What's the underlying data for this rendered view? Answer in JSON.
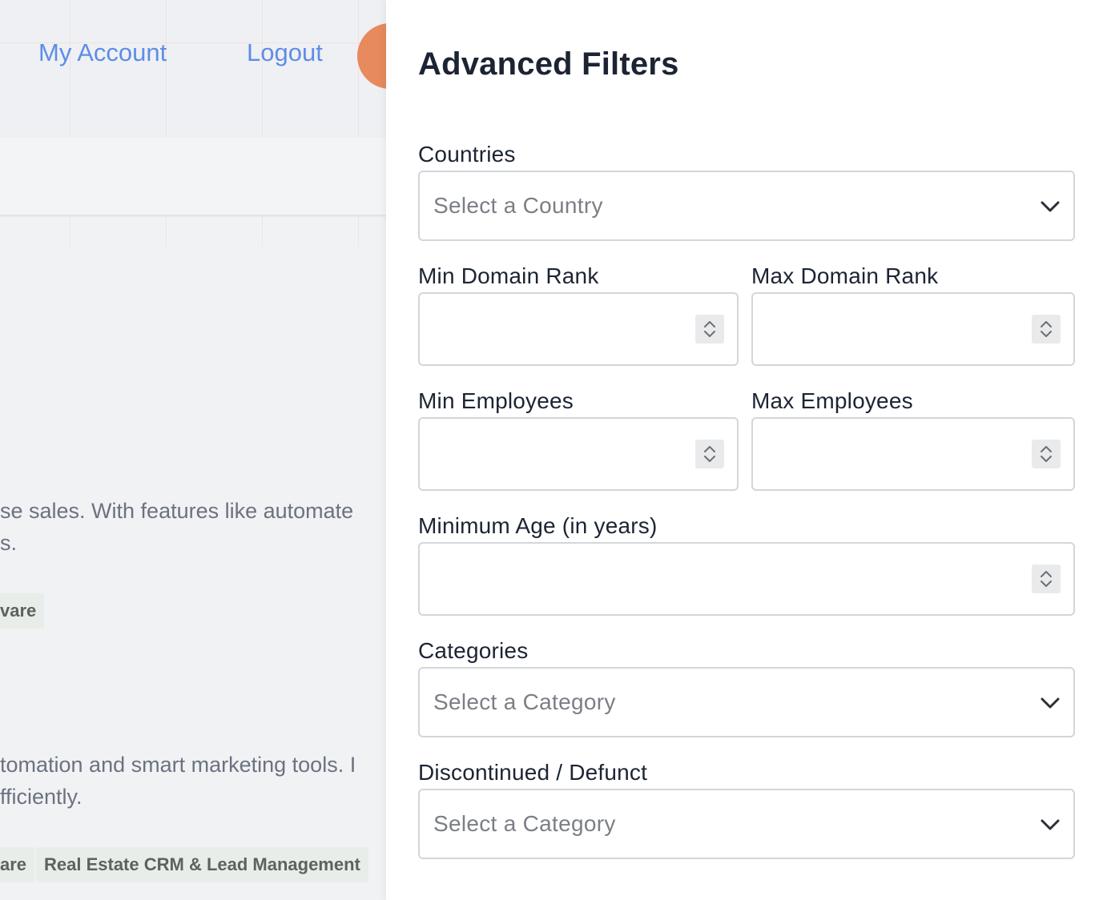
{
  "nav": {
    "my_account": "My Account",
    "logout": "Logout"
  },
  "background": {
    "listing_1": {
      "description_line_1": "se sales. With features like automate",
      "description_line_2": "s.",
      "tag_1": "vare"
    },
    "listing_2": {
      "description_line_1": "tomation and smart marketing tools. I",
      "description_line_2": "fficiently.",
      "tag_1": "are",
      "tag_2": "Real Estate CRM & Lead Management"
    }
  },
  "filters": {
    "title": "Advanced Filters",
    "countries": {
      "label": "Countries",
      "placeholder": "Select a Country"
    },
    "min_domain_rank": {
      "label": "Min Domain Rank",
      "value": ""
    },
    "max_domain_rank": {
      "label": "Max Domain Rank",
      "value": ""
    },
    "min_employees": {
      "label": "Min Employees",
      "value": ""
    },
    "max_employees": {
      "label": "Max Employees",
      "value": ""
    },
    "minimum_age": {
      "label": "Minimum Age (in years)",
      "value": ""
    },
    "categories": {
      "label": "Categories",
      "placeholder": "Select a Category"
    },
    "discontinued": {
      "label": "Discontinued / Defunct",
      "placeholder": "Select a Category"
    }
  },
  "colors": {
    "link": "#5f8de6",
    "avatar": "#e78a5d",
    "text_dark": "#1c2433",
    "placeholder": "#7b7f85",
    "border": "#d3d6da"
  },
  "icons": {
    "select_arrow": "chevron-down-icon",
    "number_spinner": "spinner-icon"
  }
}
